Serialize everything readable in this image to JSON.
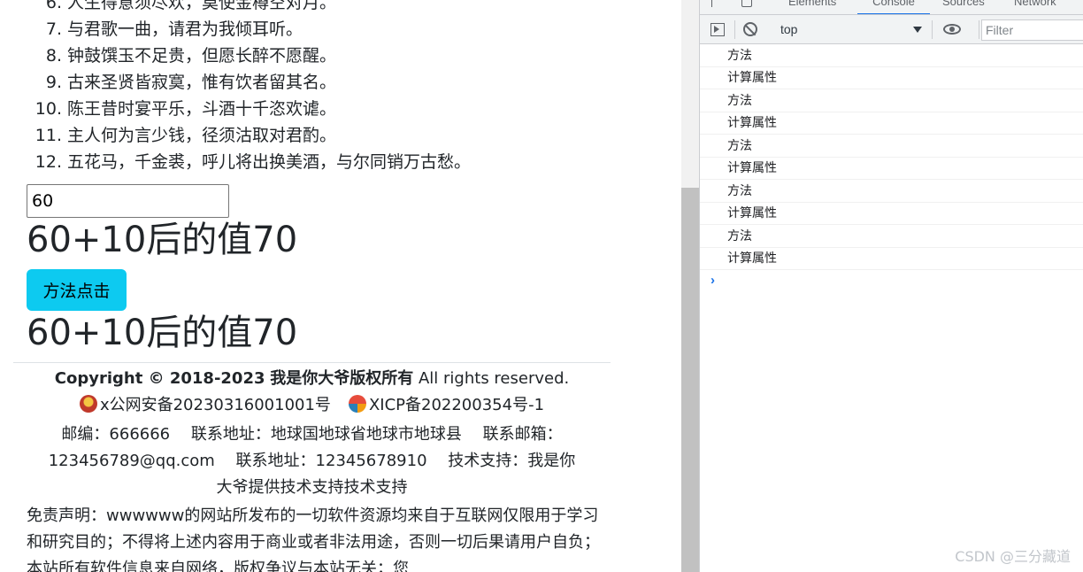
{
  "poem": {
    "lines": [
      {
        "num": "6.",
        "text": "人生得意须尽欢，莫使金樽空对月。"
      },
      {
        "num": "7.",
        "text": "与君歌一曲，请君为我倾耳听。"
      },
      {
        "num": "8.",
        "text": "钟鼓馔玉不足贵，但愿长醉不愿醒。"
      },
      {
        "num": "9.",
        "text": "古来圣贤皆寂寞，惟有饮者留其名。"
      },
      {
        "num": "10.",
        "text": "陈王昔时宴平乐，斗酒十千恣欢谑。"
      },
      {
        "num": "11.",
        "text": "主人何为言少钱，径须沽取对君酌。"
      },
      {
        "num": "12.",
        "text": "五花马，千金裘，呼儿将出换美酒，与尔同销万古愁。"
      }
    ]
  },
  "demo": {
    "input_value": "60",
    "computed_result": "60+10后的值70",
    "method_button_label": "方法点击",
    "method_result": "60+10后的值70"
  },
  "footer": {
    "copyright_prefix": "Copyright © 2018-2023",
    "copyright_owner": "我是你大爷版权所有",
    "copyright_suffix": "All rights reserved.",
    "police_beian": "x公网安备20230316001001号",
    "icp_beian": "XICP备202200354号-1",
    "contact_line_1": "邮编：666666　 联系地址：地球国地球省地球市地球县　 联系邮箱：",
    "contact_line_2": "123456789@qq.com　 联系地址：12345678910　 技术支持：我是你",
    "contact_line_3": "大爷提供技术支持技术支持",
    "disclaimer": "免责声明：wwwwww的网站所发布的一切软件资源均来自于互联网仅限用于学习和研究目的；不得将上述内容用于商业或者非法用途，否则一切后果请用户自负；本站所有软件信息来自网络，版权争议与本站无关；您"
  },
  "devtools": {
    "tabs": [
      "Elements",
      "Console",
      "Sources",
      "Network"
    ],
    "active_tab": "Console",
    "context": "top",
    "filter_placeholder": "Filter",
    "messages": [
      "方法",
      "计算属性",
      "方法",
      "计算属性",
      "方法",
      "计算属性",
      "方法",
      "计算属性",
      "方法",
      "计算属性"
    ],
    "accent_color": "#1a73e8"
  },
  "watermark": "CSDN @三分藏道",
  "colors": {
    "button_bg": "#0dcaf0",
    "scroll_thumb": "#c1c1c1"
  }
}
